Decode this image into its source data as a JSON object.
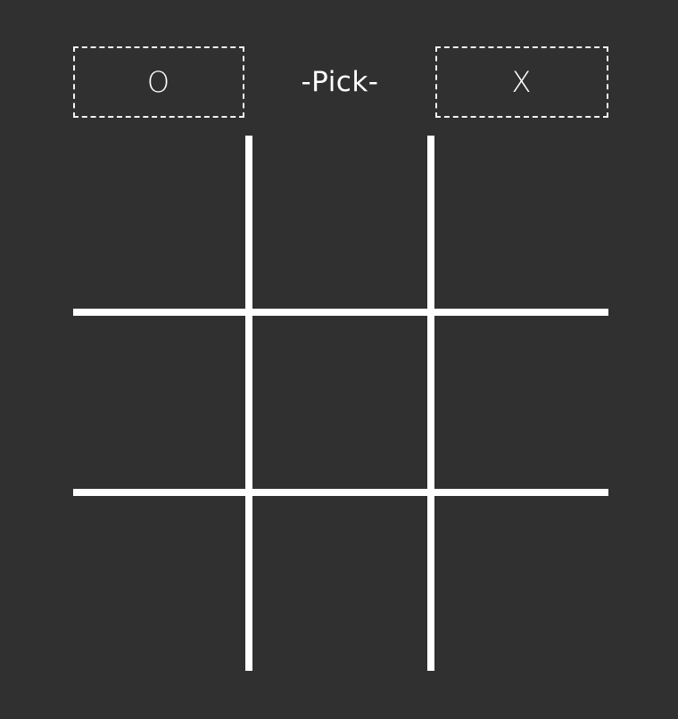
{
  "header": {
    "o_label": "O",
    "pick_label": "-Pick-",
    "x_label": "X"
  },
  "board": {
    "cells": [
      "",
      "",
      "",
      "",
      "",
      "",
      "",
      "",
      ""
    ]
  },
  "colors": {
    "background": "#303030",
    "foreground": "#ffffff"
  }
}
